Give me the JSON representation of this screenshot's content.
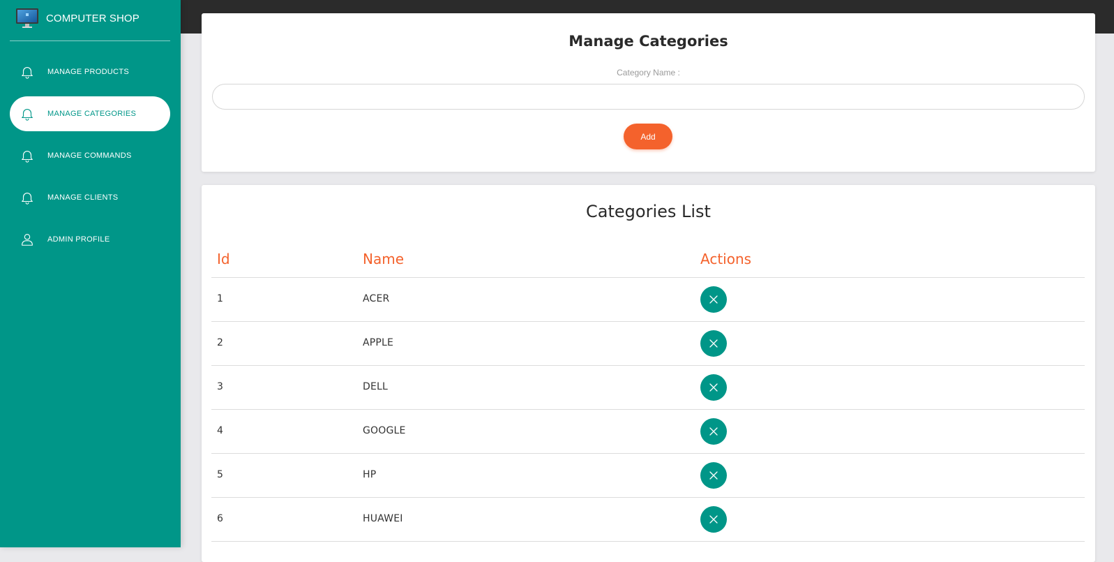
{
  "brand": {
    "name": "COMPUTER SHOP",
    "logo_icon": "computer-monitor-icon"
  },
  "sidebar": {
    "items": [
      {
        "label": "MANAGE PRODUCTS",
        "icon": "bell-icon",
        "active": false
      },
      {
        "label": "MANAGE CATEGORIES",
        "icon": "bell-icon",
        "active": true
      },
      {
        "label": "MANAGE COMMANDS",
        "icon": "bell-icon",
        "active": false
      },
      {
        "label": "MANAGE CLIENTS",
        "icon": "bell-icon",
        "active": false
      },
      {
        "label": "ADMIN PROFILE",
        "icon": "user-icon",
        "active": false
      }
    ]
  },
  "form": {
    "title": "Manage Categories",
    "field_label": "Category Name :",
    "field_value": "",
    "add_label": "Add"
  },
  "list": {
    "title": "Categories List",
    "columns": [
      "Id",
      "Name",
      "Actions"
    ],
    "rows": [
      {
        "id": "1",
        "name": "ACER"
      },
      {
        "id": "2",
        "name": "APPLE"
      },
      {
        "id": "3",
        "name": "DELL"
      },
      {
        "id": "4",
        "name": "GOOGLE"
      },
      {
        "id": "5",
        "name": "HP"
      },
      {
        "id": "6",
        "name": "HUAWEI"
      }
    ],
    "delete_icon": "close-icon"
  },
  "colors": {
    "primary": "#009688",
    "accent": "#f4622c",
    "topbar": "#2b2b2b"
  }
}
